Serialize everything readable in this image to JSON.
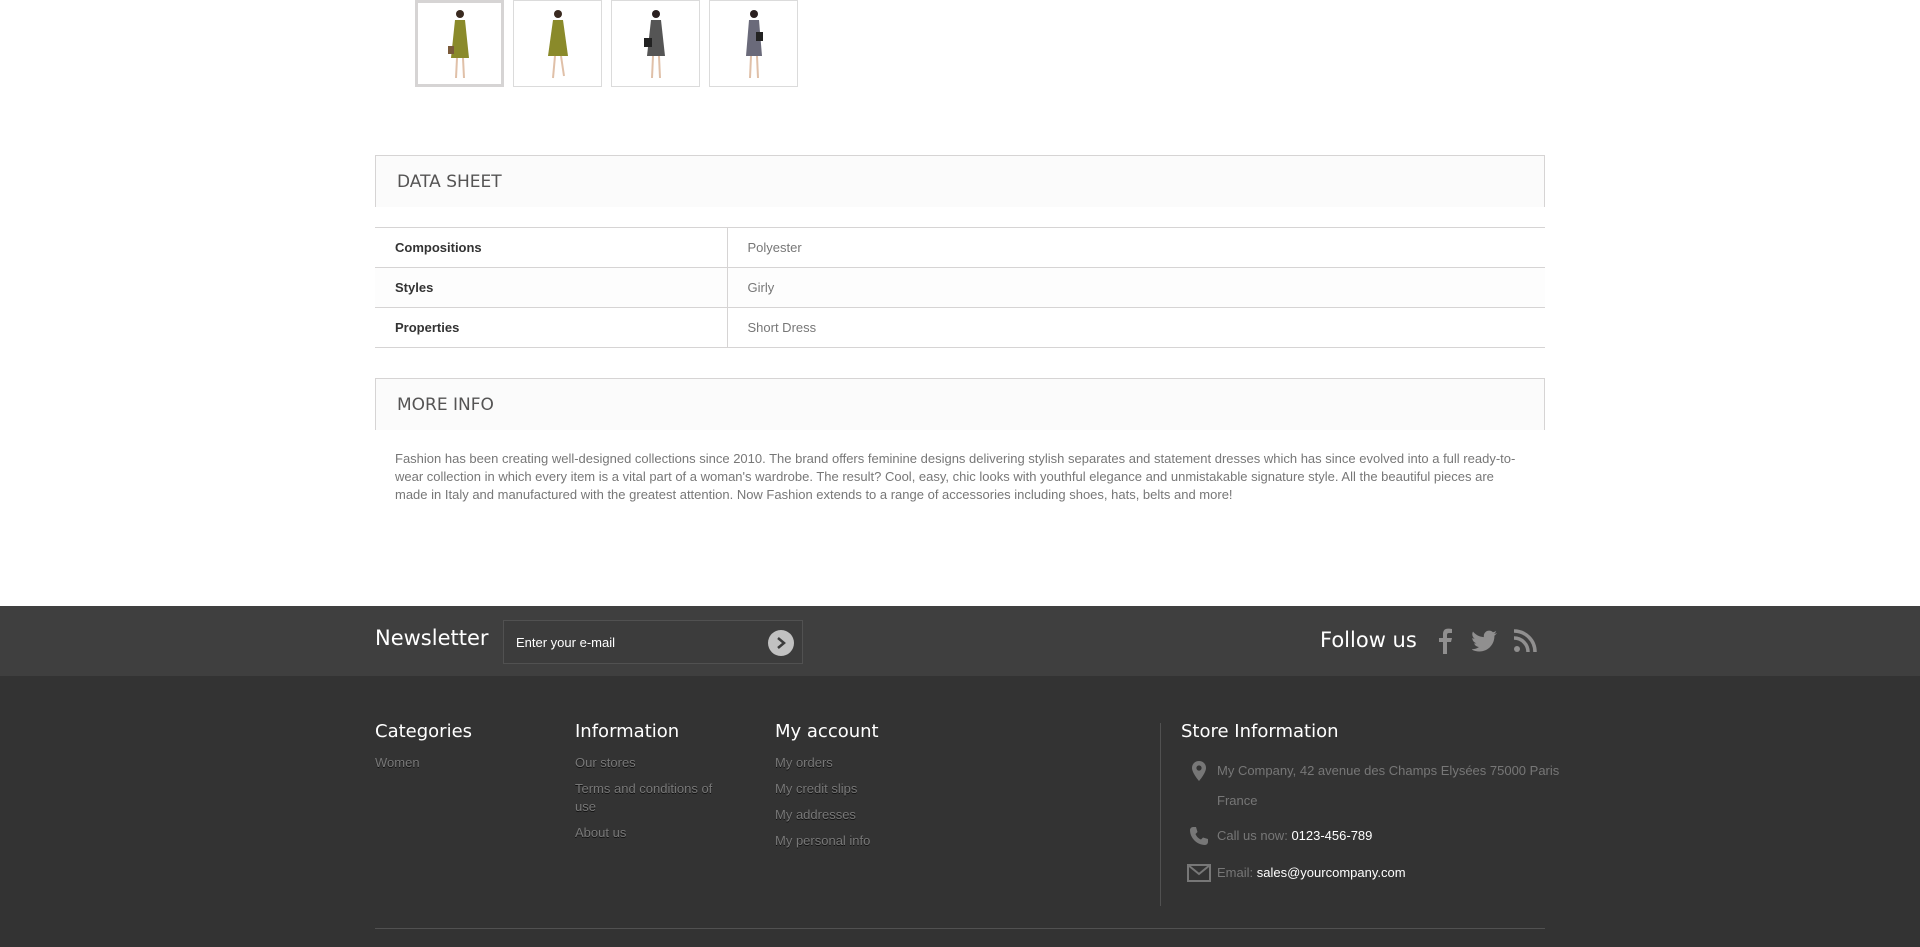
{
  "thumbnails": [
    {
      "alt": "dress-yellow-front",
      "dress_color": "#8a8a2a",
      "bag_color": "#7a5a3a"
    },
    {
      "alt": "dress-yellow-pose",
      "dress_color": "#8a8a2a",
      "bag_color": "#7a5a3a"
    },
    {
      "alt": "dress-print-front",
      "dress_color": "#555555",
      "bag_color": "#222222"
    },
    {
      "alt": "dress-print-pose",
      "dress_color": "#6a6a7a",
      "bag_color": "#222222"
    }
  ],
  "data_sheet": {
    "title": "DATA SHEET",
    "rows": [
      {
        "key": "Compositions",
        "value": "Polyester"
      },
      {
        "key": "Styles",
        "value": "Girly"
      },
      {
        "key": "Properties",
        "value": "Short Dress"
      }
    ]
  },
  "more_info": {
    "title": "MORE INFO",
    "text": "Fashion has been creating well-designed collections since 2010. The brand offers feminine designs delivering stylish separates and statement dresses which has since evolved into a full ready-to-wear collection in which every item is a vital part of a woman's wardrobe. The result? Cool, easy, chic looks with youthful elegance and unmistakable signature style. All the beautiful pieces are made in Italy and manufactured with the greatest attention. Now Fashion extends to a range of accessories including shoes, hats, belts and more!"
  },
  "newsletter": {
    "title": "Newsletter",
    "placeholder": "Enter your e-mail",
    "follow_title": "Follow us",
    "social": [
      "facebook-icon",
      "twitter-icon",
      "rss-icon"
    ]
  },
  "footer": {
    "categories": {
      "title": "Categories",
      "items": [
        "Women"
      ]
    },
    "information": {
      "title": "Information",
      "items": [
        "Our stores",
        "Terms and conditions of use",
        "About us"
      ]
    },
    "my_account": {
      "title": "My account",
      "items": [
        "My orders",
        "My credit slips",
        "My addresses",
        "My personal info"
      ]
    },
    "store": {
      "title": "Store Information",
      "address": "My Company, 42 avenue des Champs Elysées 75000 Paris France",
      "phone_label": "Call us now:",
      "phone": "0123-456-789",
      "email_label": "Email:",
      "email": "sales@yourcompany.com"
    }
  },
  "colors": {
    "footer_bg": "#333333",
    "newsletter_bg": "#3f3f3f"
  }
}
